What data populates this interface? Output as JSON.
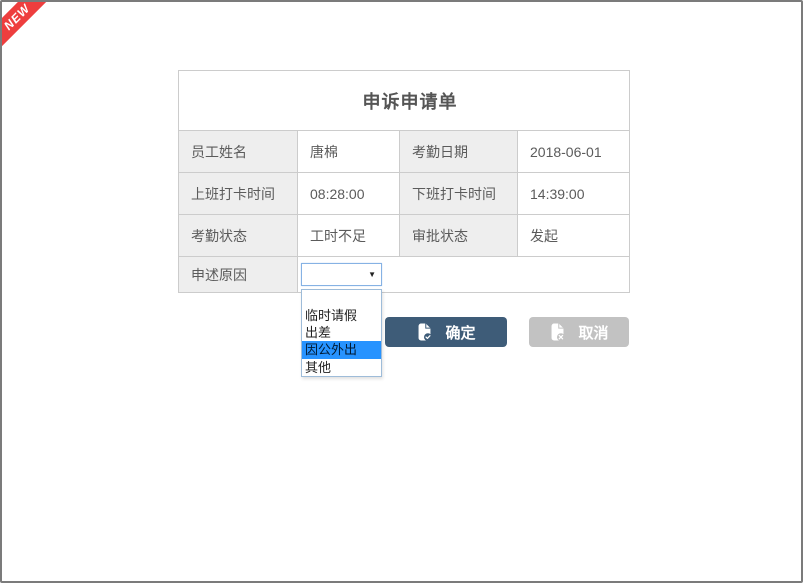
{
  "ribbon": {
    "label": "NEW"
  },
  "form": {
    "title": "申诉申请单",
    "fields": {
      "employee_name": {
        "label": "员工姓名",
        "value": "唐棉"
      },
      "attendance_date": {
        "label": "考勤日期",
        "value": "2018-06-01"
      },
      "clock_in_time": {
        "label": "上班打卡时间",
        "value": "08:28:00"
      },
      "clock_out_time": {
        "label": "下班打卡时间",
        "value": "14:39:00"
      },
      "attendance_status": {
        "label": "考勤状态",
        "value": "工时不足"
      },
      "approval_status": {
        "label": "审批状态",
        "value": "发起"
      },
      "appeal_reason": {
        "label": "申述原因"
      }
    }
  },
  "select": {
    "selected_value": "",
    "options": [
      "",
      "临时请假",
      "出差",
      "因公外出",
      "其他"
    ],
    "highlighted_option": "因公外出"
  },
  "buttons": {
    "confirm_label": "确定",
    "cancel_label": "取消"
  },
  "colors": {
    "ribbon_red": "#ee3e3e",
    "confirm_button": "#3e5c78",
    "cancel_button": "#c2c2c2",
    "option_highlight": "#2793ff",
    "label_cell_bg": "#eeeeee",
    "table_border": "#cccccc",
    "select_border": "#86b2e4",
    "frame_border": "#7b7b7b"
  }
}
